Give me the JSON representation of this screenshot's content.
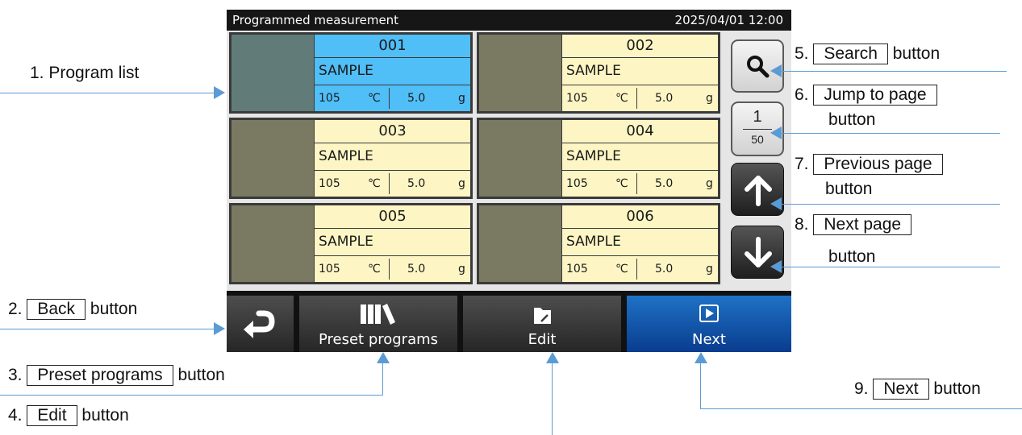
{
  "screen": {
    "title": "Programmed measurement",
    "datetime": "2025/04/01  12:00"
  },
  "programs": [
    {
      "number": "001",
      "name": "SAMPLE",
      "temperature": "105",
      "temp_unit": "℃",
      "weight": "5.0",
      "weight_unit": "g",
      "selected": true
    },
    {
      "number": "002",
      "name": "SAMPLE",
      "temperature": "105",
      "temp_unit": "℃",
      "weight": "5.0",
      "weight_unit": "g",
      "selected": false
    },
    {
      "number": "003",
      "name": "SAMPLE",
      "temperature": "105",
      "temp_unit": "℃",
      "weight": "5.0",
      "weight_unit": "g",
      "selected": false
    },
    {
      "number": "004",
      "name": "SAMPLE",
      "temperature": "105",
      "temp_unit": "℃",
      "weight": "5.0",
      "weight_unit": "g",
      "selected": false
    },
    {
      "number": "005",
      "name": "SAMPLE",
      "temperature": "105",
      "temp_unit": "℃",
      "weight": "5.0",
      "weight_unit": "g",
      "selected": false
    },
    {
      "number": "006",
      "name": "SAMPLE",
      "temperature": "105",
      "temp_unit": "℃",
      "weight": "5.0",
      "weight_unit": "g",
      "selected": false
    }
  ],
  "pager": {
    "current": "1",
    "total": "50"
  },
  "side_buttons": {
    "search_icon": "magnifier-icon",
    "prev_icon": "arrow-up-icon",
    "next_icon": "arrow-down-icon"
  },
  "bottom_bar": {
    "back_icon": "return-arrow-icon",
    "preset_label": "Preset programs",
    "preset_icon": "books-icon",
    "edit_label": "Edit",
    "edit_icon": "folder-pencil-icon",
    "next_label": "Next",
    "next_icon": "play-icon"
  },
  "annotations": {
    "a1": {
      "prefix": "1. Program list"
    },
    "a2": {
      "prefix": "2.",
      "boxed": "Back",
      "suffix": "button"
    },
    "a3": {
      "prefix": "3.",
      "boxed": "Preset programs",
      "suffix": "button"
    },
    "a4": {
      "prefix": "4.",
      "boxed": "Edit",
      "suffix": "button"
    },
    "a5": {
      "prefix": "5.",
      "boxed": "Search",
      "suffix": "button"
    },
    "a6": {
      "prefix": "6.",
      "boxed": "Jump to page",
      "suffix": "button"
    },
    "a7": {
      "prefix": "7.",
      "boxed": "Previous page",
      "suffix": "button"
    },
    "a8": {
      "prefix": "8.",
      "boxed": "Next page",
      "suffix": "button"
    },
    "a9": {
      "prefix": "9.",
      "boxed": "Next",
      "suffix": "button"
    }
  },
  "colors": {
    "selected_card": "#50bef7",
    "card_bg": "#fdf6c4",
    "next_button": "#0a3c8e",
    "leader_line": "#5b9bd5"
  }
}
